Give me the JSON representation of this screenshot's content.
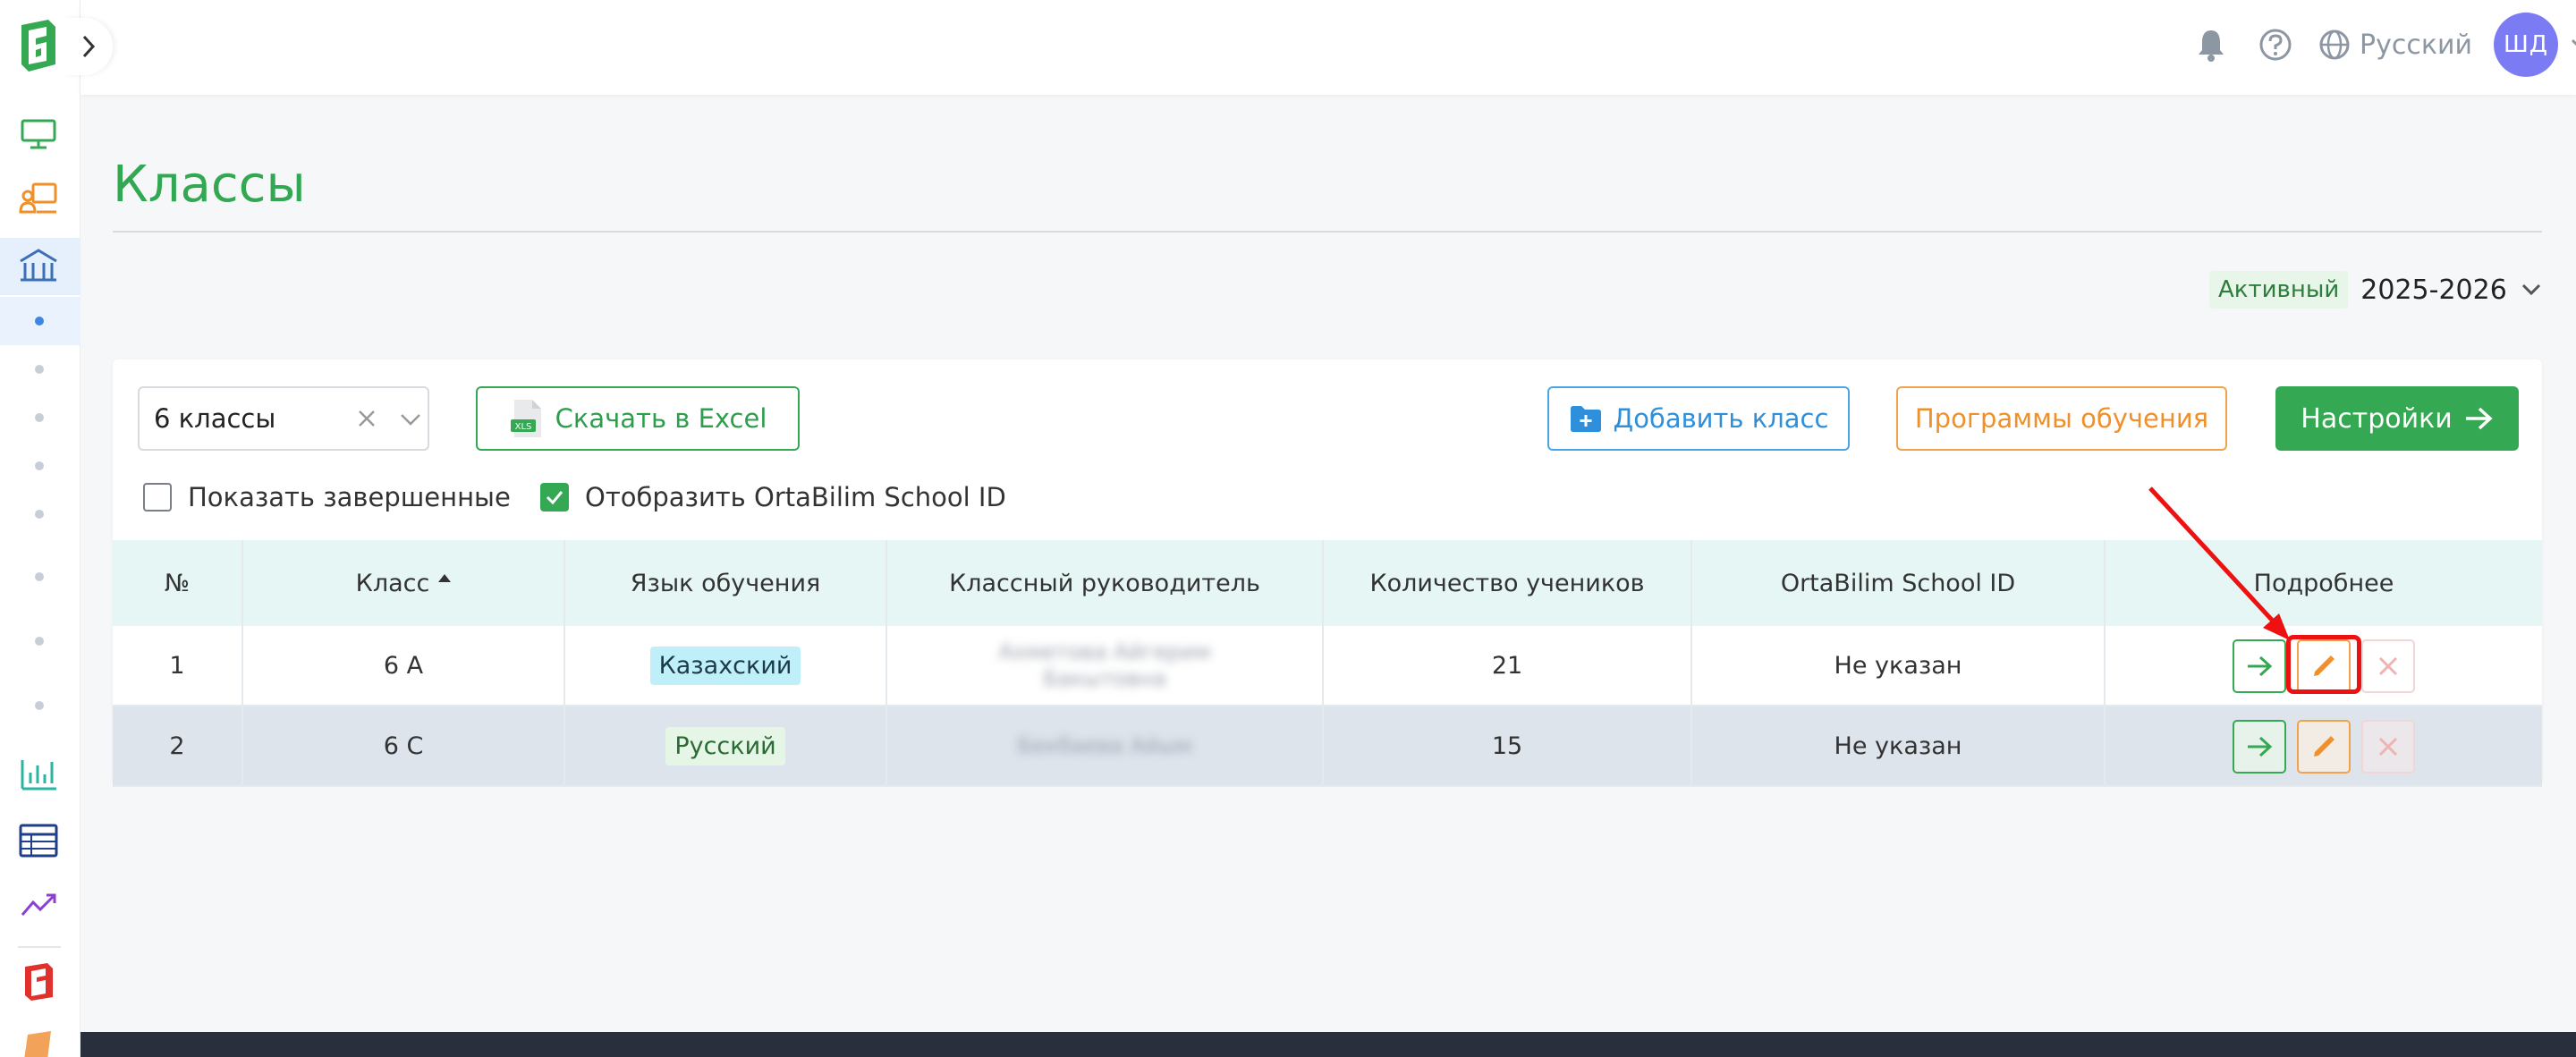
{
  "topbar": {
    "language": "Русский",
    "avatar_initials": "ШД"
  },
  "page": {
    "title": "Классы"
  },
  "year": {
    "status": "Активный",
    "value": "2025-2026"
  },
  "filters": {
    "grade_select_value": "6 классы",
    "excel_label": "Скачать в Excel",
    "add_label": "Добавить класс",
    "programs_label": "Программы обучения",
    "settings_label": "Настройки",
    "show_finished_label": "Показать завершенные",
    "show_finished_checked": false,
    "show_id_label": "Отобразить OrtaBilim School ID",
    "show_id_checked": true
  },
  "table": {
    "headers": [
      "№",
      "Класс",
      "Язык обучения",
      "Классный руководитель",
      "Количество учеников",
      "OrtaBilim School ID",
      "Подробнее"
    ],
    "rows": [
      {
        "num": "1",
        "class": "6 A",
        "language": "Казахский",
        "teacher": "Ахметова Айгерим Бакытовна",
        "students": "21",
        "school_id": "Не указан"
      },
      {
        "num": "2",
        "class": "6 C",
        "language": "Русский",
        "teacher": "Бекбаева Айым",
        "students": "15",
        "school_id": "Не указан"
      }
    ]
  },
  "colors": {
    "brand_green": "#35a853",
    "title_green": "#33a852",
    "add_blue": "#2e8fda",
    "programs_orange": "#f0902a",
    "annotation_red": "#ee1111"
  }
}
